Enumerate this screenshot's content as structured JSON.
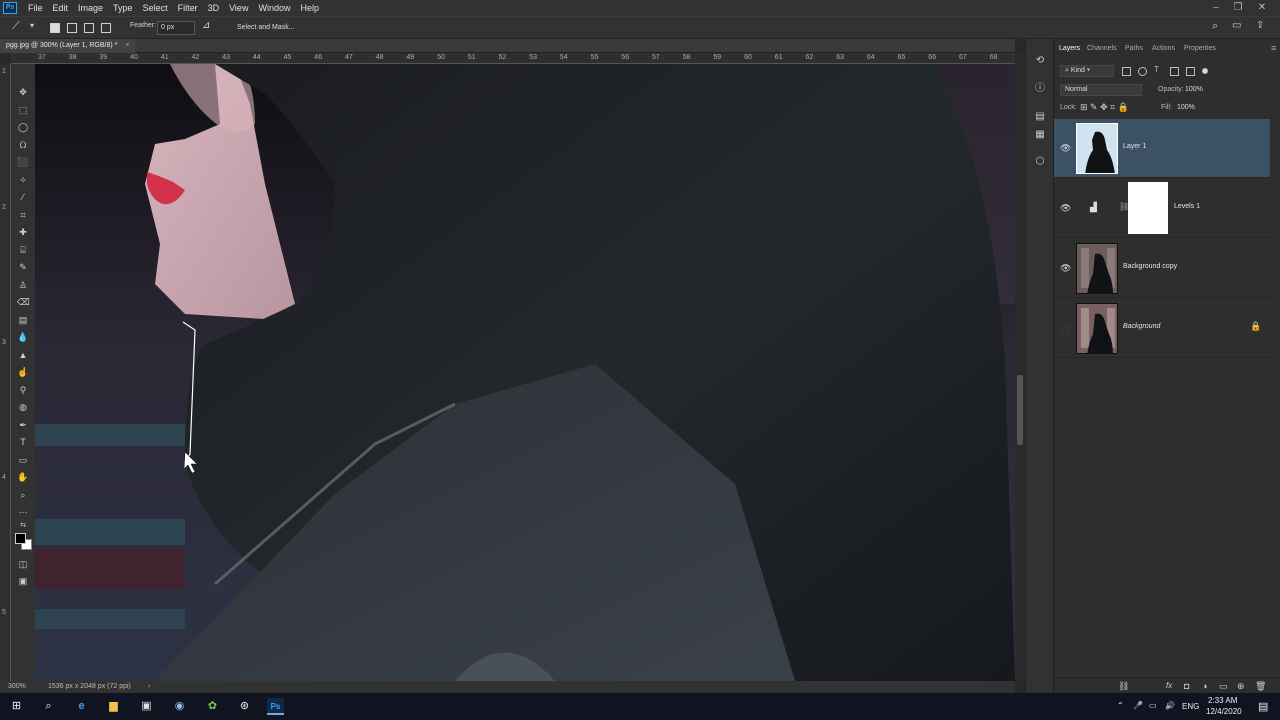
{
  "menubar": {
    "app_icon": "Ps",
    "items": [
      "File",
      "Edit",
      "Image",
      "Type",
      "Select",
      "Filter",
      "3D",
      "View",
      "Window",
      "Help"
    ],
    "window_controls": [
      "minimize",
      "restore",
      "close"
    ]
  },
  "optionsbar": {
    "feather_label": "Feather:",
    "feather_value": "0 px",
    "select_mask_label": "Select and Mask..."
  },
  "document": {
    "tab_title": "pgg.jpg @ 300% (Layer 1, RGB/8) *",
    "close": "×"
  },
  "ruler": {
    "top_labels": [
      "37",
      "38",
      "39",
      "40",
      "41",
      "42",
      "43",
      "44",
      "45",
      "46",
      "47",
      "48",
      "49",
      "50",
      "51",
      "52",
      "53",
      "54",
      "55",
      "56",
      "57",
      "58",
      "59",
      "60",
      "61",
      "62",
      "63",
      "64",
      "65",
      "66",
      "67",
      "68"
    ],
    "left_labels": [
      "1",
      "2",
      "3",
      "4",
      "5"
    ]
  },
  "status": {
    "zoom": "300%",
    "doc_info": "1536 px x 2048 px (72 ppi)",
    "arrow": "›"
  },
  "panel": {
    "tabs": [
      "Layers",
      "Channels",
      "Paths",
      "Actions",
      "Properties"
    ],
    "active_tab": "Layers",
    "filter_kind": "Kind",
    "blend_mode": "Normal",
    "opacity_label": "Opacity:",
    "opacity_value": "100%",
    "lock_label": "Lock:",
    "fill_label": "Fill:",
    "fill_value": "100%",
    "layers": [
      {
        "name": "Layer 1",
        "visible": true,
        "selected": true
      },
      {
        "name": "Levels 1",
        "visible": true,
        "selected": false
      },
      {
        "name": "Background copy",
        "visible": true,
        "selected": false
      },
      {
        "name": "Background",
        "visible": false,
        "selected": false,
        "locked": true
      }
    ],
    "bottom_icons": [
      "link-icon",
      "fx-icon",
      "mask-icon",
      "adjustment-icon",
      "group-icon",
      "new-layer-icon",
      "trash-icon"
    ]
  },
  "taskbar": {
    "apps": [
      "windows-start-icon",
      "search-icon",
      "edge-icon",
      "explorer-icon",
      "store-icon",
      "camera-icon",
      "android-icon",
      "media-icon",
      "photoshop-icon"
    ],
    "lang": "ENG",
    "time": "2:33 AM",
    "date": "12/4/2020"
  },
  "colors": {
    "accent": "#31a8ff",
    "selected_layer": "#3c5066",
    "canvas_bg": "#1a1d25"
  }
}
